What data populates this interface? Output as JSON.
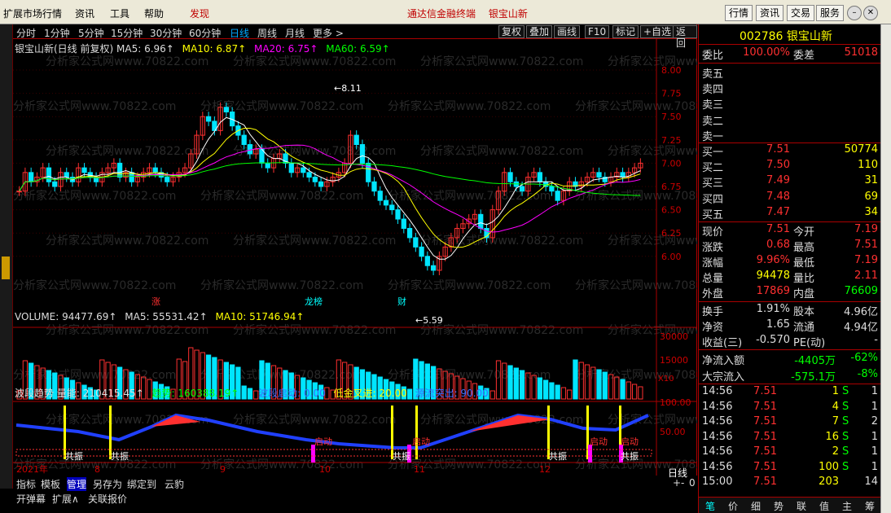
{
  "menu": {
    "items": [
      "扩展市场行情",
      "资讯",
      "工具",
      "帮助",
      "发现"
    ],
    "center": [
      "通达信金融终端",
      "银宝山新"
    ],
    "buttons": [
      "行情",
      "资讯",
      "交易",
      "服务"
    ]
  },
  "periods": [
    "分时",
    "1分钟",
    "5分钟",
    "15分钟",
    "30分钟",
    "60分钟",
    "日线",
    "周线",
    "月线",
    "更多 >"
  ],
  "toolbar_right": [
    "复权",
    "叠加",
    "画线",
    "F10",
    "标记",
    "+自选",
    "返回"
  ],
  "kline_header": {
    "title": "银宝山新(日线 前复权)",
    "ma5": "MA5: 6.96↑",
    "ma10": "MA10: 6.87↑",
    "ma20": "MA20: 6.75↑",
    "ma60": "MA60: 6.59↑"
  },
  "volume_header": {
    "title": "VOLUME: 94477.69↑",
    "ma5": "MA5: 55531.42↑",
    "ma10": "MA10: 51746.94↑"
  },
  "indicator_header": {
    "name": "波段趋势",
    "liang": "量能: 210415.45↑",
    "qushi": "趋势: 160388.19↑",
    "boduan": "波段启动: 0.00",
    "dijin": "低金叉进: 20.00",
    "yuanjing": "源流突出: 90.00"
  },
  "price_axis": [
    "8.00",
    "7.75",
    "7.50",
    "7.25",
    "7.00",
    "6.75",
    "6.50",
    "6.25",
    "6.00"
  ],
  "volume_axis": [
    "30000",
    "15000"
  ],
  "volume_unit": "X10",
  "indicator_axis": [
    "100.00",
    "50.00"
  ],
  "annotations": {
    "high": "8.11",
    "low": "5.59",
    "zhang": "涨",
    "longhu": "龙榜",
    "cai": "财",
    "gongzhen": "共振",
    "qidong": "启动"
  },
  "date_axis": [
    "2021年",
    "8",
    "9",
    "10",
    "11",
    "12"
  ],
  "bottom_tabs_row1": [
    "指标",
    "模板",
    "管理",
    "另存为",
    "绑定到",
    "云豹"
  ],
  "bottom_tabs_row2": [
    "开弹幕",
    "扩展∧",
    "关联报价"
  ],
  "period_label": "日线",
  "zoom_buttons": [
    "+",
    "-",
    "0"
  ],
  "quote": {
    "code": "002786",
    "name": "银宝山新",
    "weibi_label": "委比",
    "weibi": "100.00%",
    "weicha_label": "委差",
    "weicha": "51018",
    "sell": [
      {
        "label": "卖五",
        "price": "",
        "vol": ""
      },
      {
        "label": "卖四",
        "price": "",
        "vol": ""
      },
      {
        "label": "卖三",
        "price": "",
        "vol": ""
      },
      {
        "label": "卖二",
        "price": "",
        "vol": ""
      },
      {
        "label": "卖一",
        "price": "",
        "vol": ""
      }
    ],
    "buy": [
      {
        "label": "买一",
        "price": "7.51",
        "vol": "50774"
      },
      {
        "label": "买二",
        "price": "7.50",
        "vol": "110"
      },
      {
        "label": "买三",
        "price": "7.49",
        "vol": "31"
      },
      {
        "label": "买四",
        "price": "7.48",
        "vol": "69"
      },
      {
        "label": "买五",
        "price": "7.47",
        "vol": "34"
      }
    ],
    "stats": [
      [
        "现价",
        "7.51",
        "今开",
        "7.19"
      ],
      [
        "涨跌",
        "0.68",
        "最高",
        "7.51"
      ],
      [
        "涨幅",
        "9.96%",
        "最低",
        "7.19"
      ],
      [
        "总量",
        "94478",
        "量比",
        "2.11"
      ],
      [
        "外盘",
        "17869",
        "内盘",
        "76609"
      ]
    ],
    "stats2": [
      [
        "换手",
        "1.91%",
        "股本",
        "4.96亿"
      ],
      [
        "净资",
        "1.65",
        "流通",
        "4.94亿"
      ],
      [
        "收益(三)",
        "-0.570",
        "PE(动)",
        "-"
      ]
    ],
    "flow": [
      [
        "净流入额",
        "-4405万",
        "-62%"
      ],
      [
        "大宗流入",
        "-575.1万",
        "-8%"
      ]
    ],
    "ticks": [
      [
        "14:56",
        "7.51",
        "1",
        "S",
        "1"
      ],
      [
        "14:56",
        "7.51",
        "4",
        "S",
        "1"
      ],
      [
        "14:56",
        "7.51",
        "7",
        "S",
        "2"
      ],
      [
        "14:56",
        "7.51",
        "16",
        "S",
        "1"
      ],
      [
        "14:56",
        "7.51",
        "2",
        "S",
        "1"
      ],
      [
        "14:56",
        "7.51",
        "100",
        "S",
        "1"
      ],
      [
        "15:00",
        "7.51",
        "203",
        "",
        "14"
      ]
    ],
    "bottom_tabs": [
      "笔",
      "价",
      "细",
      "势",
      "联",
      "值",
      "主",
      "筹"
    ]
  },
  "watermark": "分析家公式网www.70822.com"
}
